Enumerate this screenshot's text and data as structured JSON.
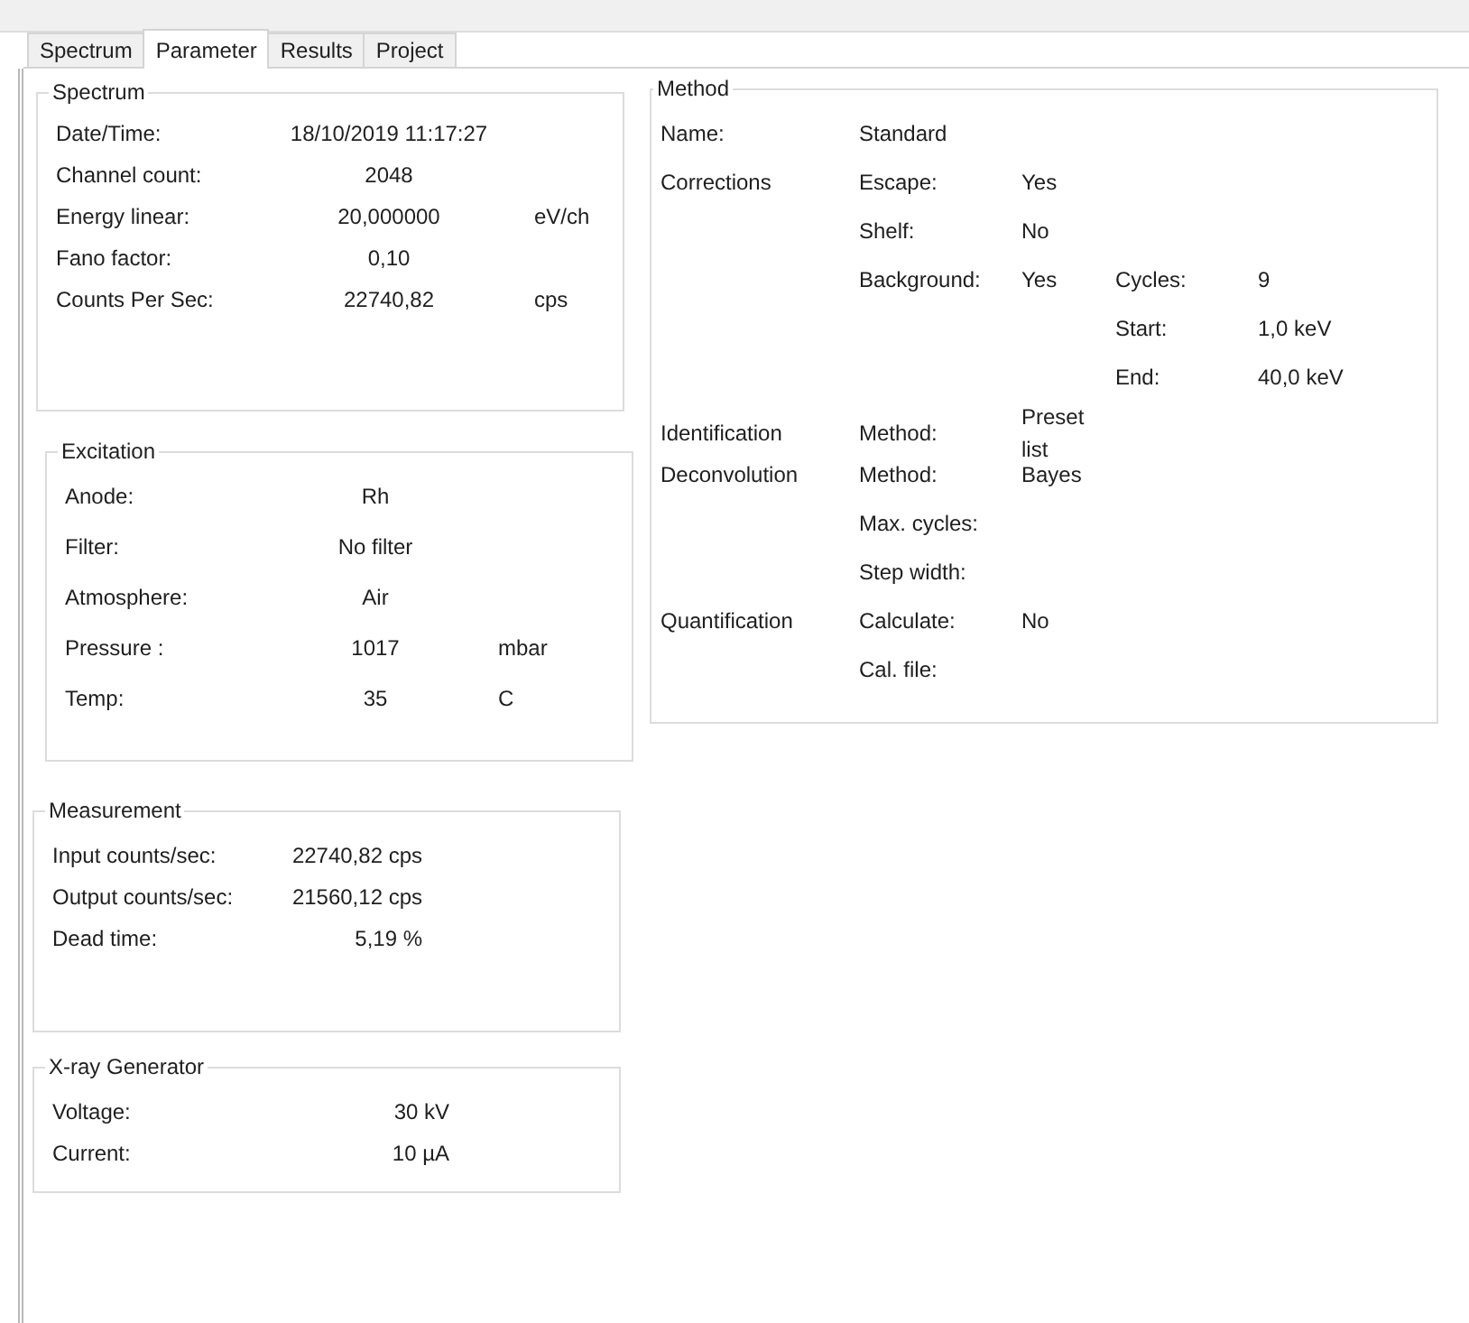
{
  "tabs": [
    {
      "label": "Spectrum",
      "selected": false
    },
    {
      "label": "Parameter",
      "selected": true
    },
    {
      "label": "Results",
      "selected": false
    },
    {
      "label": "Project",
      "selected": false
    }
  ],
  "left_groups": [
    {
      "title": "Spectrum",
      "rows": [
        {
          "label": "Date/Time:",
          "value": "18/10/2019 11:17:27"
        },
        {
          "label": "Channel count:",
          "value": "2048"
        },
        {
          "label": "Energy linear:",
          "value": "20,000000",
          "unit": "eV/ch"
        },
        {
          "label": "Fano factor:",
          "value": "0,10"
        },
        {
          "label": "Counts Per Sec:",
          "value": "22740,82",
          "unit": "cps"
        }
      ]
    },
    {
      "title": "Excitation",
      "rows": [
        {
          "label": "Anode:",
          "value": "Rh"
        },
        {
          "label": "Filter:",
          "value": "No filter"
        },
        {
          "label": "Atmosphere:",
          "value": "Air"
        },
        {
          "label": "Pressure :",
          "value": "1017",
          "unit": "mbar"
        },
        {
          "label": "Temp:",
          "value": "35",
          "unit": "C"
        }
      ]
    },
    {
      "title": "Measurement",
      "rows": [
        {
          "label": "Input counts/sec:",
          "value": "22740,82 cps"
        },
        {
          "label": "Output counts/sec:",
          "value": "21560,12 cps"
        },
        {
          "label": "Dead time:",
          "value": "5,19 %"
        }
      ]
    },
    {
      "title": "X-ray Generator",
      "rows": [
        {
          "label": "Voltage:",
          "value": "30 kV"
        },
        {
          "label": "Current:",
          "value": "10 µA"
        }
      ]
    }
  ],
  "method": {
    "title": "Method",
    "rows": [
      {
        "heading": "Name:",
        "label": "Standard"
      },
      {
        "heading": "Corrections",
        "label": "Escape:",
        "value": "Yes"
      },
      {
        "label": "Shelf:",
        "value": "No"
      },
      {
        "label": "Background:",
        "value": "Yes",
        "sub_label": "Cycles:",
        "sub_value": "9"
      },
      {
        "sub_label": "Start:",
        "sub_value": "1,0 keV"
      },
      {
        "sub_label": "End:",
        "sub_value": "40,0 keV"
      },
      {
        "heading": "Identification",
        "label": "Method:",
        "value": "Preset list"
      },
      {
        "heading": "Deconvolution",
        "label": "Method:",
        "value": "Bayes"
      },
      {
        "label": "Max. cycles:"
      },
      {
        "label": "Step width:"
      },
      {
        "heading": "Quantification",
        "label": "Calculate:",
        "value": "No"
      },
      {
        "label": "Cal. file:"
      }
    ]
  }
}
